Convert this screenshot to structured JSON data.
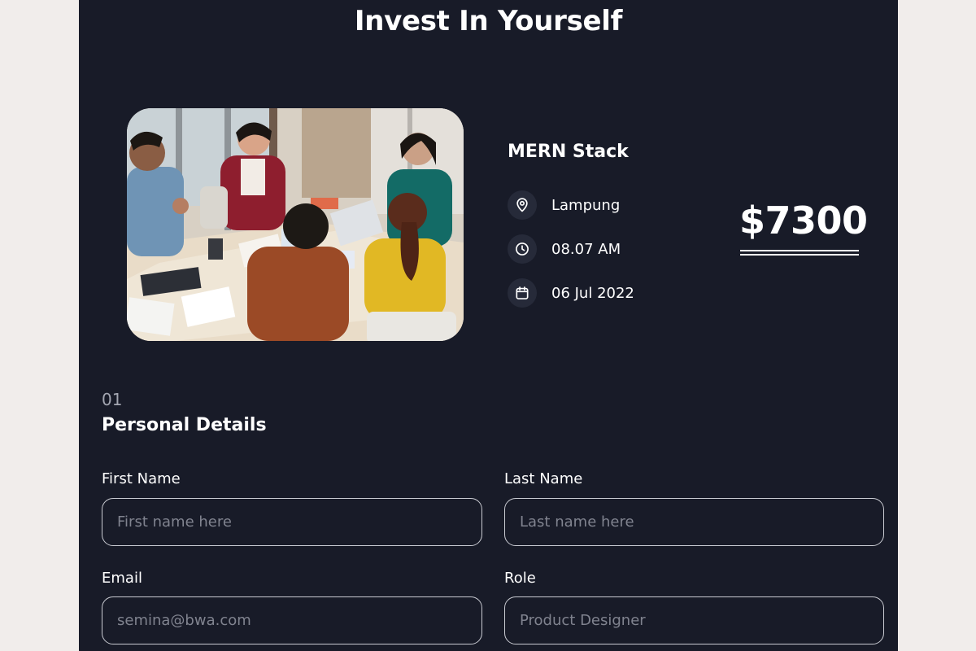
{
  "page": {
    "title": "Invest In Yourself"
  },
  "course": {
    "name": "MERN Stack",
    "location": "Lampung",
    "time": "08.07 AM",
    "date": "06 Jul 2022",
    "price": "$7300"
  },
  "icons": {
    "location": "location-pin-icon",
    "time": "clock-icon",
    "date": "calendar-icon"
  },
  "form": {
    "step": "01",
    "section_title": "Personal Details",
    "fields": {
      "first_name": {
        "label": "First Name",
        "placeholder": "First name here",
        "value": ""
      },
      "last_name": {
        "label": "Last Name",
        "placeholder": "Last name here",
        "value": ""
      },
      "email": {
        "label": "Email",
        "placeholder": "semina@bwa.com",
        "value": ""
      },
      "role": {
        "label": "Role",
        "placeholder": "Product Designer",
        "value": ""
      }
    }
  },
  "colors": {
    "page_background": "#f1edeb",
    "panel_background": "#181b28",
    "icon_circle": "#262a39",
    "text": "#ffffff",
    "muted_text": "#a3a6b1",
    "input_border": "#c9cbd2"
  }
}
